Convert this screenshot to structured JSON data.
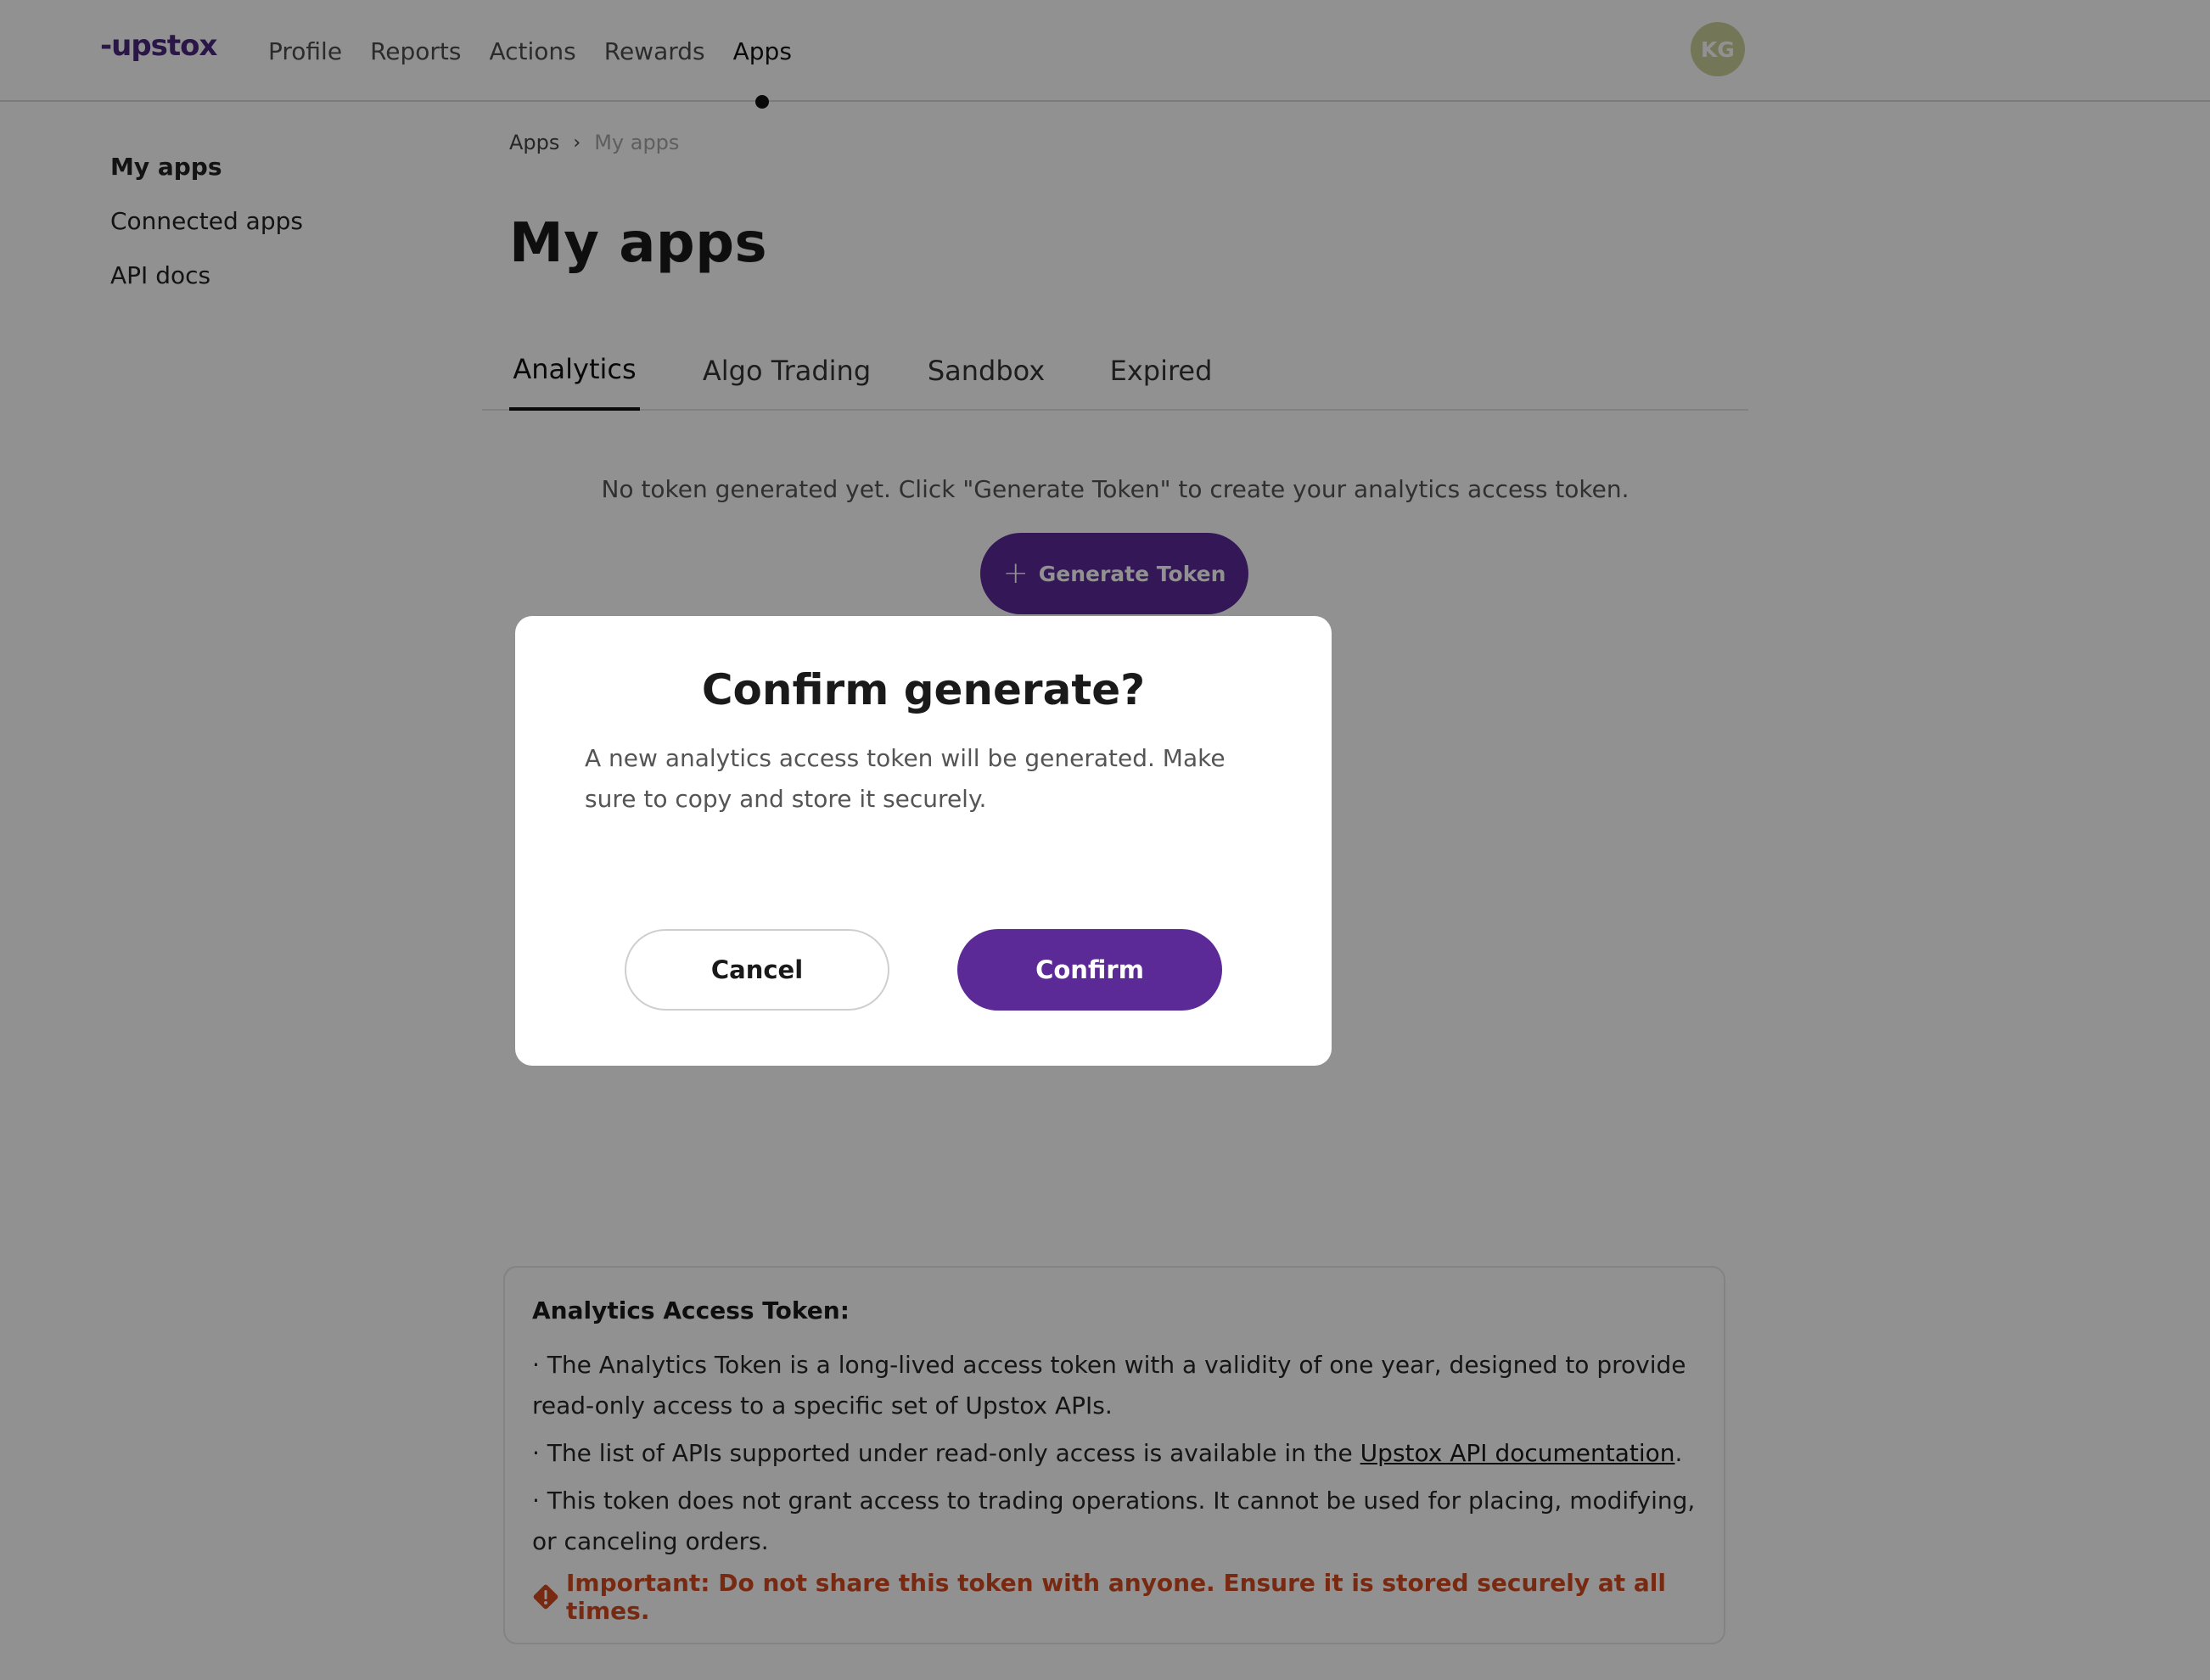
{
  "header": {
    "logo_text": "upstox",
    "nav": [
      {
        "label": "Profile"
      },
      {
        "label": "Reports"
      },
      {
        "label": "Actions"
      },
      {
        "label": "Rewards"
      },
      {
        "label": "Apps",
        "active": true
      }
    ],
    "avatar_initials": "KG"
  },
  "sidebar": {
    "items": [
      {
        "label": "My apps",
        "active": true
      },
      {
        "label": "Connected apps"
      },
      {
        "label": "API docs"
      }
    ]
  },
  "breadcrumb": {
    "root": "Apps",
    "separator": "›",
    "current": "My apps"
  },
  "main": {
    "title": "My apps",
    "tabs": [
      {
        "label": "Analytics",
        "active": true
      },
      {
        "label": "Algo Trading"
      },
      {
        "label": "Sandbox"
      },
      {
        "label": "Expired"
      }
    ],
    "empty_message": "No token generated yet. Click \"Generate Token\" to create your analytics access token.",
    "generate_button": {
      "icon": "plus-icon",
      "label": "Generate Token"
    }
  },
  "info_card": {
    "title": "Analytics Access Token:",
    "line1": "· The Analytics Token is a long-lived access token with a validity of one year, designed to provide read-only access to a specific set of Upstox APIs.",
    "line2_prefix": "· The list of APIs supported under read-only access is available in the ",
    "line2_link": "Upstox API documentation",
    "line2_suffix": ".",
    "line3": "· This token does not grant access to trading operations. It cannot be used for placing, modifying, or canceling orders.",
    "warning": "Important: Do not share this token with anyone. Ensure it is stored securely at all times."
  },
  "modal": {
    "title": "Confirm generate?",
    "body": "A new analytics access token will be generated. Make sure to copy and store it securely.",
    "cancel_label": "Cancel",
    "confirm_label": "Confirm"
  },
  "colors": {
    "brand_purple": "#5b2a96",
    "warning_red": "#d24a1e",
    "overlay": "rgba(0,0,0,0.43)"
  }
}
